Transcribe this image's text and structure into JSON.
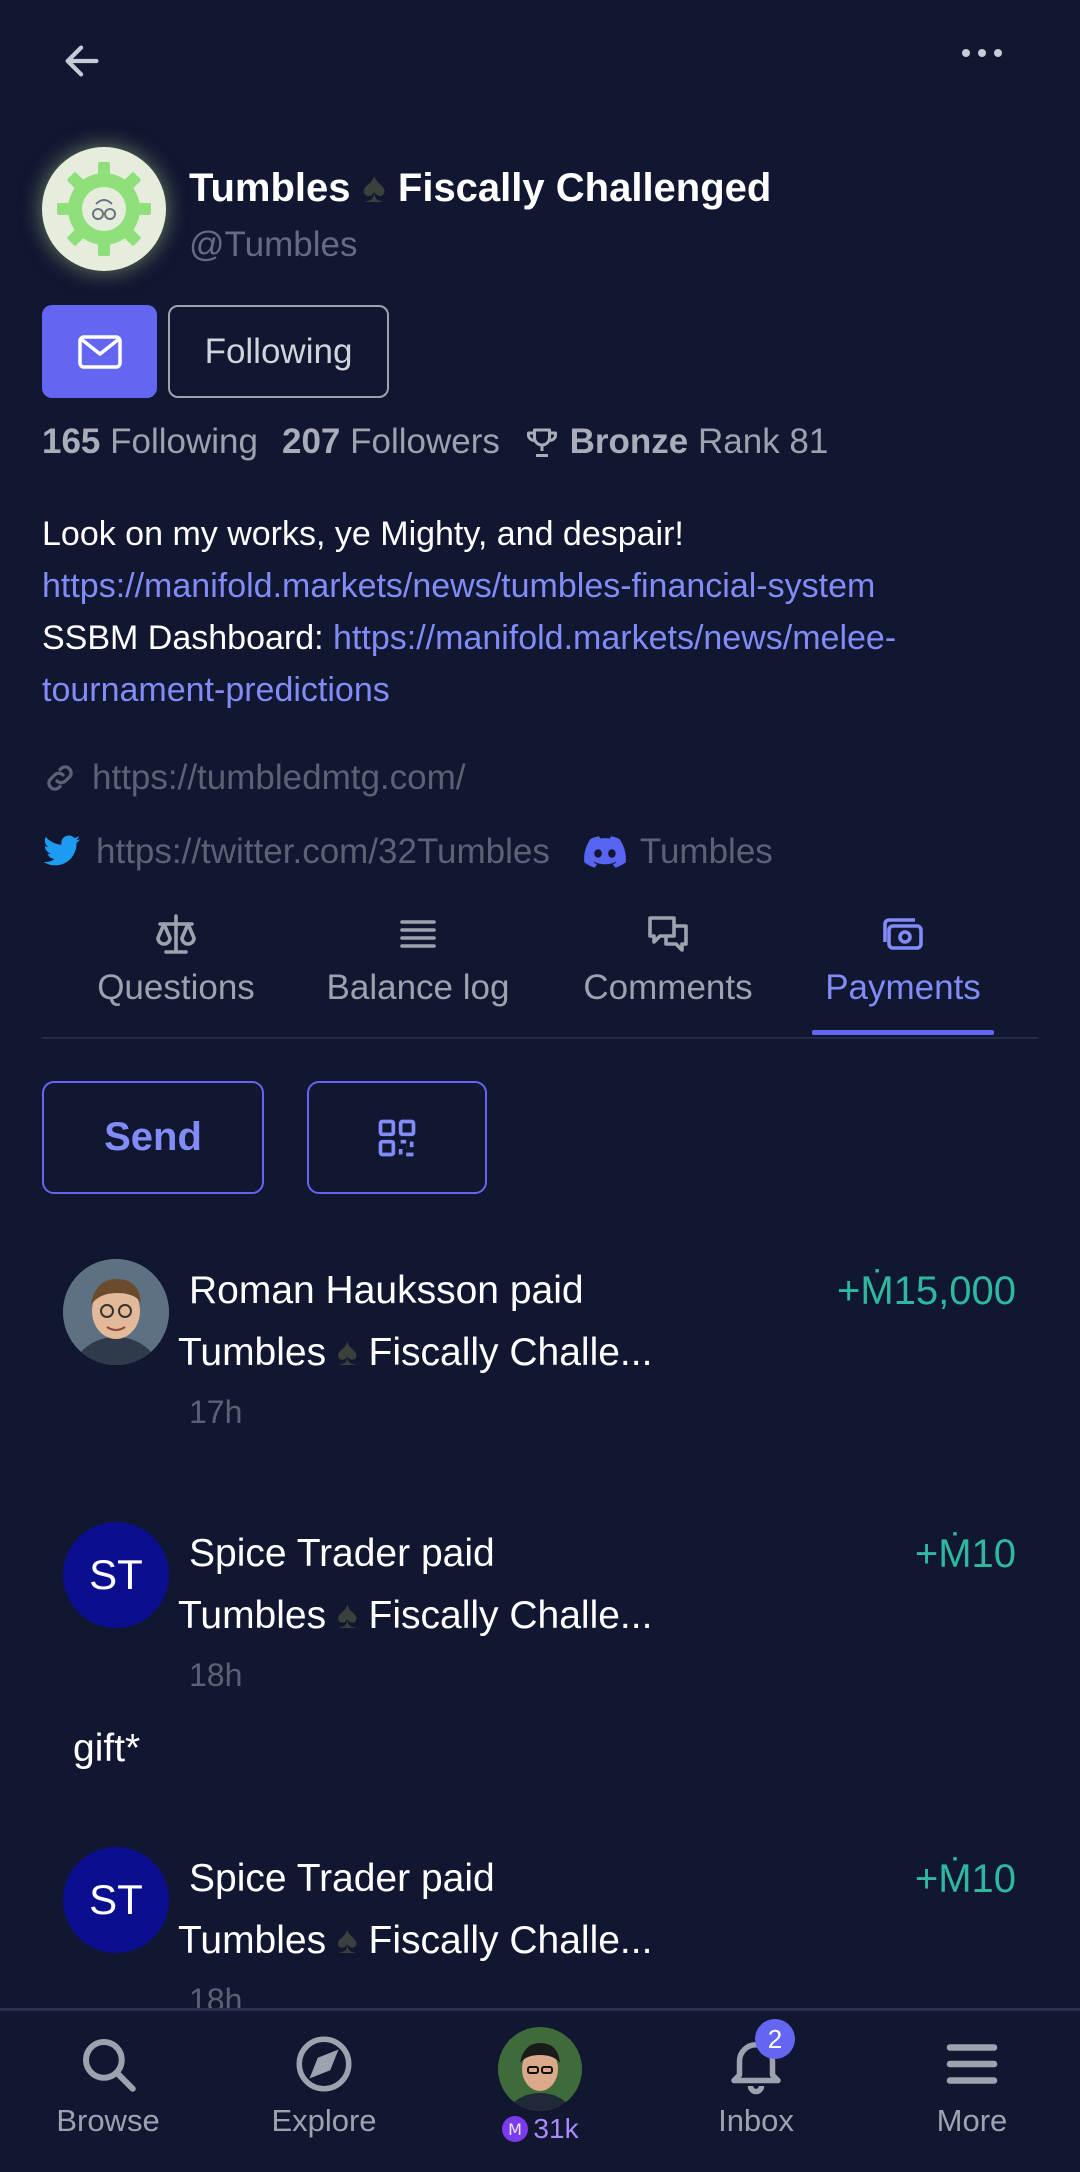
{
  "profile": {
    "display_name": "Tumbles",
    "spade_glyph": "♠",
    "display_name_suffix": "Fiscally Challenged",
    "handle": "@Tumbles",
    "following_button": "Following",
    "stats": {
      "following_count": "165",
      "following_label": "Following",
      "followers_count": "207",
      "followers_label": "Followers",
      "rank_tier": "Bronze",
      "rank_label": "Rank 81"
    },
    "bio": {
      "line1": "Look on my works, ye Mighty, and despair!",
      "link1": "https://manifold.markets/news/tumbles-financial-system",
      "dashboard_label": "SSBM Dashboard: ",
      "link2": "https://manifold.markets/news/melee-tournament-predictions"
    },
    "website": "https://tumbledmtg.com/",
    "twitter": "https://twitter.com/32Tumbles",
    "discord": "Tumbles"
  },
  "tabs": [
    {
      "label": "Questions",
      "icon": "scale-icon"
    },
    {
      "label": "Balance log",
      "icon": "list-icon"
    },
    {
      "label": "Comments",
      "icon": "chat-icon"
    },
    {
      "label": "Payments",
      "icon": "cash-icon",
      "active": true
    }
  ],
  "actions": {
    "send_label": "Send",
    "qr_icon": "qr-code-icon"
  },
  "payments": [
    {
      "payer": "Roman Hauksson paid",
      "recipient": "Tumbles",
      "recipient_suffix": "Fiscally Challe...",
      "amount": "+Ṁ15,000",
      "time": "17h",
      "avatar": "photo"
    },
    {
      "payer": "Spice Trader paid",
      "recipient": "Tumbles",
      "recipient_suffix": "Fiscally Challe...",
      "amount": "+Ṁ10",
      "time": "18h",
      "avatar_initials": "ST",
      "note": "gift*"
    },
    {
      "payer": "Spice Trader paid",
      "recipient": "Tumbles",
      "recipient_suffix": "Fiscally Challe...",
      "amount": "+Ṁ10",
      "time": "18h",
      "avatar_initials": "ST"
    }
  ],
  "bottom_nav": {
    "browse": "Browse",
    "explore": "Explore",
    "balance": "31k",
    "inbox": "Inbox",
    "inbox_badge": "2",
    "more": "More"
  },
  "colors": {
    "background": "#111631",
    "accent": "#6366f1",
    "link": "#818cf8",
    "positive": "#2eb8a0"
  }
}
